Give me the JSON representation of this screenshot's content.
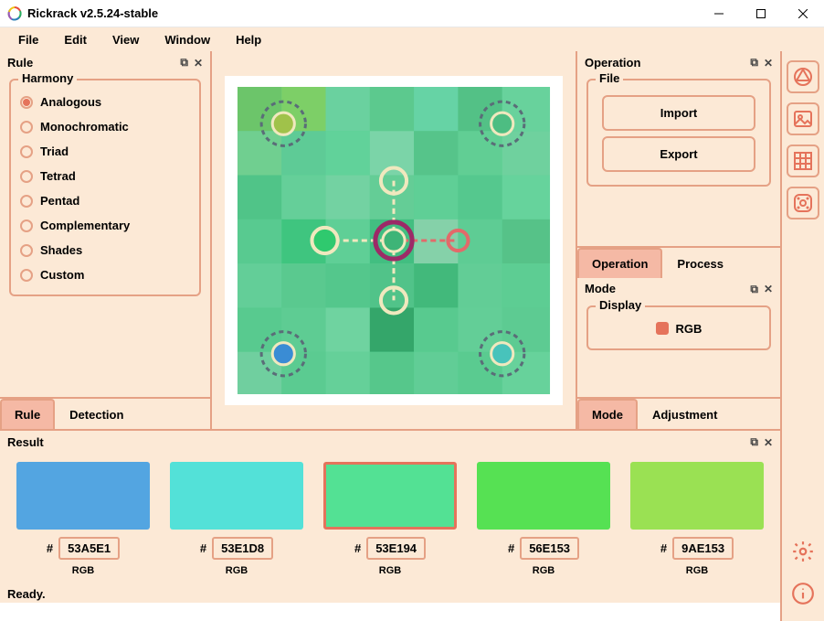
{
  "window": {
    "title": "Rickrack v2.5.24-stable"
  },
  "menubar": {
    "file": "File",
    "edit": "Edit",
    "view": "View",
    "window": "Window",
    "help": "Help"
  },
  "rule_panel": {
    "title": "Rule",
    "harmony_legend": "Harmony",
    "options": {
      "analogous": "Analogous",
      "monochromatic": "Monochromatic",
      "triad": "Triad",
      "tetrad": "Tetrad",
      "pentad": "Pentad",
      "complementary": "Complementary",
      "shades": "Shades",
      "custom": "Custom"
    },
    "tabs": {
      "rule": "Rule",
      "detection": "Detection"
    }
  },
  "operation_panel": {
    "title": "Operation",
    "file_legend": "File",
    "buttons": {
      "import": "Import",
      "export": "Export"
    },
    "tabs": {
      "operation": "Operation",
      "process": "Process"
    }
  },
  "mode_panel": {
    "title": "Mode",
    "display_legend": "Display",
    "rgb": "RGB",
    "tabs": {
      "mode": "Mode",
      "adjustment": "Adjustment"
    }
  },
  "result_panel": {
    "title": "Result",
    "hash": "#",
    "rgb": "RGB",
    "swatches": [
      {
        "hex": "53A5E1",
        "color": "#53A5E1"
      },
      {
        "hex": "53E1D8",
        "color": "#53E1D8"
      },
      {
        "hex": "53E194",
        "color": "#53E194"
      },
      {
        "hex": "56E153",
        "color": "#56E153"
      },
      {
        "hex": "9AE153",
        "color": "#9AE153"
      }
    ]
  },
  "statusbar": {
    "text": "Ready."
  }
}
